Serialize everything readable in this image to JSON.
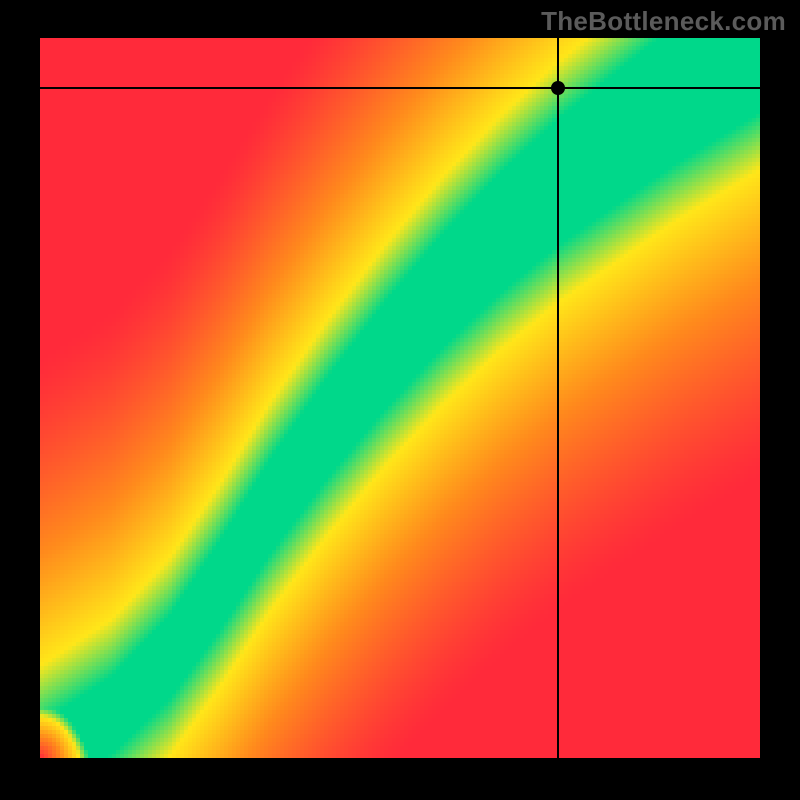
{
  "watermark": "TheBottleneck.com",
  "colors": {
    "red": "#ff2a3a",
    "orange": "#ff8a1c",
    "yellow": "#ffe619",
    "green": "#00d88a"
  },
  "chart_data": {
    "type": "heatmap",
    "description": "Bottleneck compatibility heatmap. X axis = GPU score (0–100), Y axis = CPU score (0–100). Green ridge marks balanced pairings; red regions mark heavy bottleneck on one component; yellow/orange are intermediate.",
    "xlabel": "",
    "ylabel": "",
    "xlim": [
      0,
      100
    ],
    "ylim": [
      0,
      100
    ],
    "ridge_points": [
      {
        "x": 0,
        "y": 0
      },
      {
        "x": 10,
        "y": 6
      },
      {
        "x": 18,
        "y": 14
      },
      {
        "x": 25,
        "y": 24
      },
      {
        "x": 32,
        "y": 35
      },
      {
        "x": 40,
        "y": 46
      },
      {
        "x": 48,
        "y": 56
      },
      {
        "x": 56,
        "y": 65
      },
      {
        "x": 64,
        "y": 73
      },
      {
        "x": 72,
        "y": 80
      },
      {
        "x": 80,
        "y": 86
      },
      {
        "x": 88,
        "y": 92
      },
      {
        "x": 100,
        "y": 100
      }
    ],
    "ridge_thickness_start": 1.0,
    "ridge_thickness_end": 12.0,
    "selected_point": {
      "x": 72,
      "y": 93
    },
    "title": "",
    "legend": []
  }
}
